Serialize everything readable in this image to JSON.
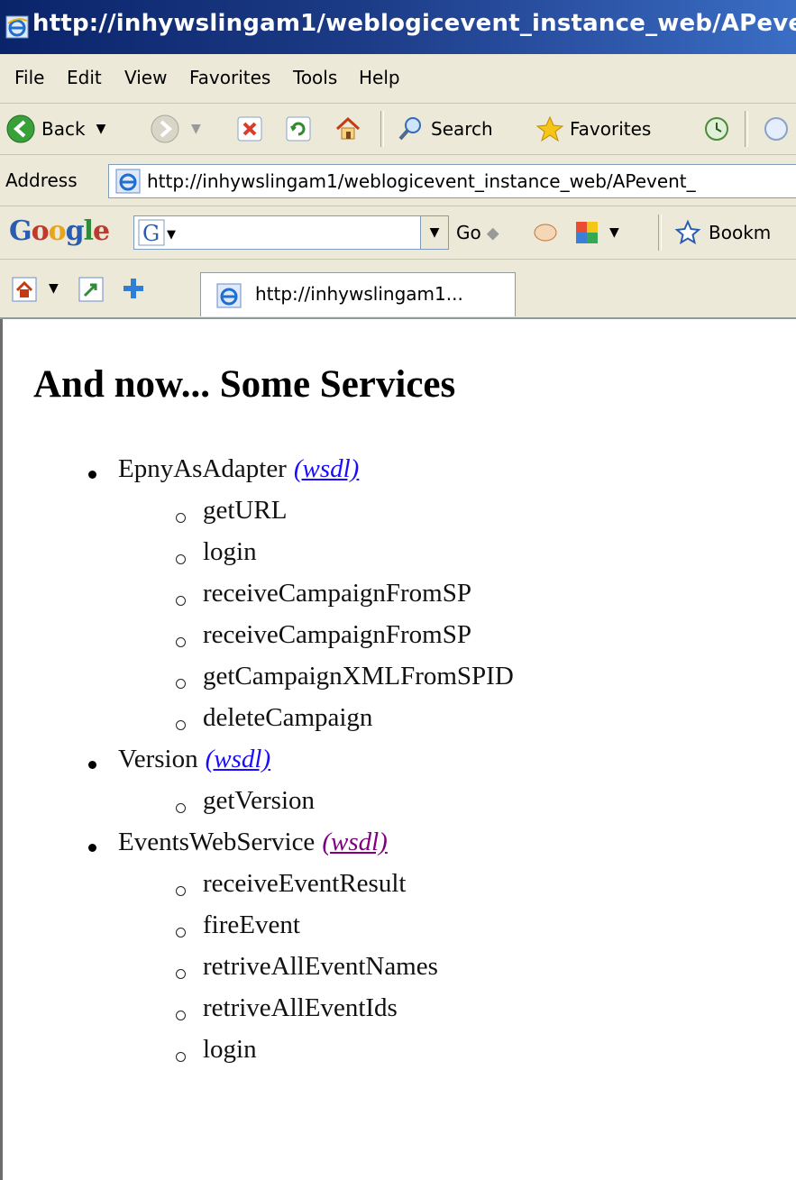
{
  "window": {
    "title": "http://inhywslingam1/weblogicevent_instance_web/APevent"
  },
  "menu": [
    "File",
    "Edit",
    "View",
    "Favorites",
    "Tools",
    "Help"
  ],
  "toolbar": {
    "back": "Back",
    "search": "Search",
    "favorites": "Favorites"
  },
  "address": {
    "label": "Address",
    "url": "http://inhywslingam1/weblogicevent_instance_web/APevent_"
  },
  "google": {
    "logo": "Google",
    "go": "Go",
    "bookmarks": "Bookm"
  },
  "tab": {
    "title": "http://inhywslingam1..."
  },
  "page": {
    "heading": "And now... Some Services",
    "services": [
      {
        "name": "EpnyAsAdapter",
        "link": "(wsdl)",
        "visited": false,
        "methods": [
          "getURL",
          "login",
          "receiveCampaignFromSP",
          "receiveCampaignFromSP",
          "getCampaignXMLFromSPID",
          "deleteCampaign"
        ]
      },
      {
        "name": "Version",
        "link": "(wsdl)",
        "visited": false,
        "methods": [
          "getVersion"
        ]
      },
      {
        "name": "EventsWebService",
        "link": "(wsdl)",
        "visited": true,
        "methods": [
          "receiveEventResult",
          "fireEvent",
          "retriveAllEventNames",
          "retriveAllEventIds",
          "login"
        ]
      }
    ]
  }
}
